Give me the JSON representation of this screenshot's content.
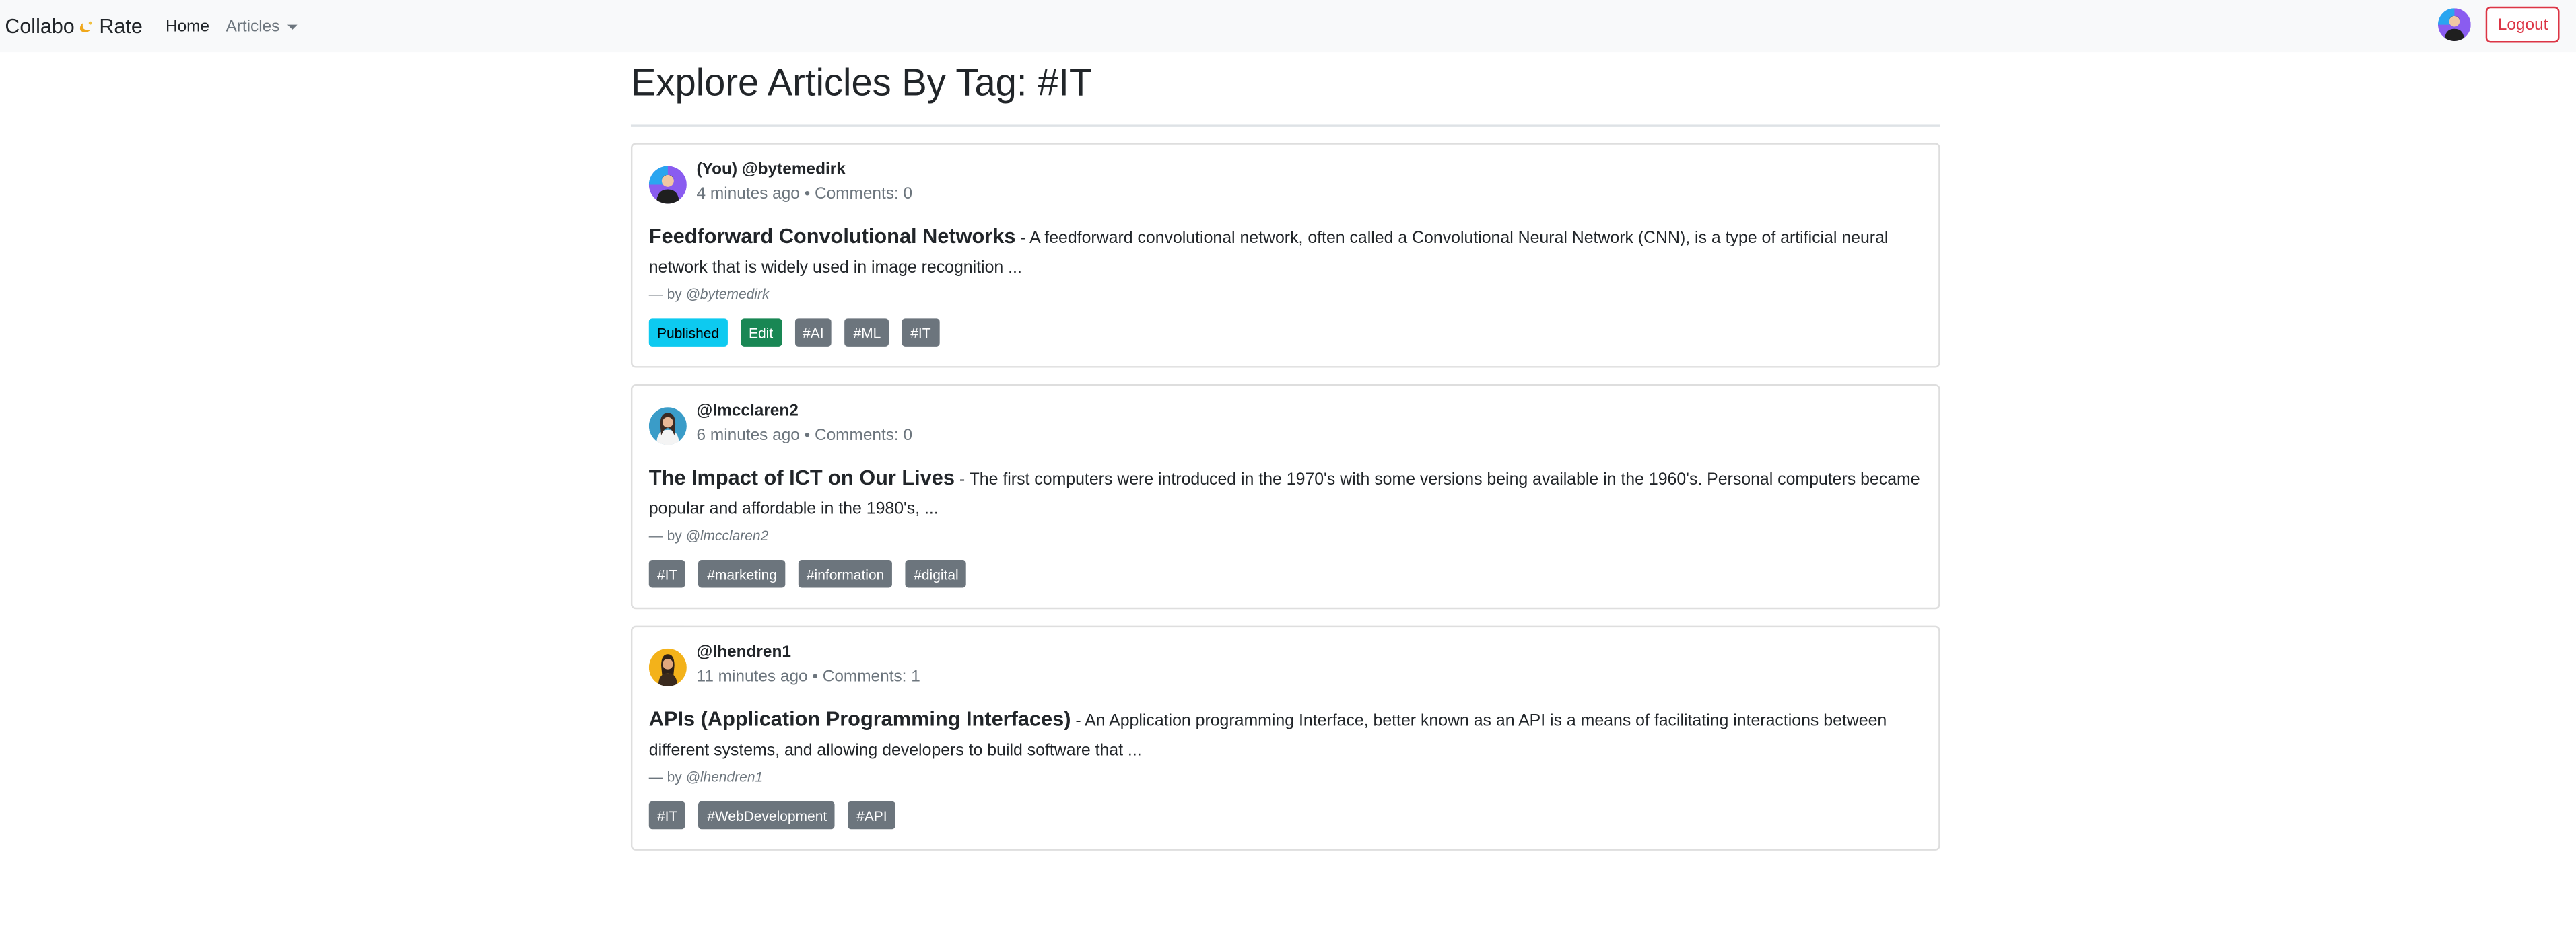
{
  "nav": {
    "brand_left": "Collabo",
    "brand_right": "Rate",
    "home": "Home",
    "articles": "Articles",
    "logout": "Logout"
  },
  "page": {
    "title": "Explore Articles By Tag: #IT"
  },
  "articles": [
    {
      "handle": "(You) @bytemedirk",
      "time": "4 minutes ago",
      "comments": "Comments: 0",
      "title": "Feedforward Convolutional Networks",
      "excerpt": " - A feedforward convolutional network, often called a Convolutional Neural Network (CNN), is a type of artificial neural network that is widely used in image recognition ...",
      "by": "@bytemedirk",
      "status": "Published",
      "edit": "Edit",
      "tags": [
        "#AI",
        "#ML",
        "#IT"
      ]
    },
    {
      "handle": "@lmcclaren2",
      "time": "6 minutes ago",
      "comments": "Comments: 0",
      "title": "The Impact of ICT on Our Lives",
      "excerpt": " - The first computers were introduced in the 1970's with some versions being available in the 1960's. Personal computers became popular and affordable in the 1980's, ...",
      "by": "@lmcclaren2",
      "tags": [
        "#IT",
        "#marketing",
        "#information",
        "#digital"
      ]
    },
    {
      "handle": "@lhendren1",
      "time": "11 minutes ago",
      "comments": "Comments: 1",
      "title": "APIs (Application Programming Interfaces)",
      "excerpt": " - An Application programming Interface, better known as an API is a means of facilitating interactions between different systems, and allowing developers to build software that ...",
      "by": "@lhendren1",
      "tags": [
        "#IT",
        "#WebDevelopment",
        "#API"
      ]
    }
  ],
  "colors": {
    "published": "#0dcaf0",
    "edit": "#198754",
    "tag": "#6c757d",
    "logout": "#dc3545"
  }
}
